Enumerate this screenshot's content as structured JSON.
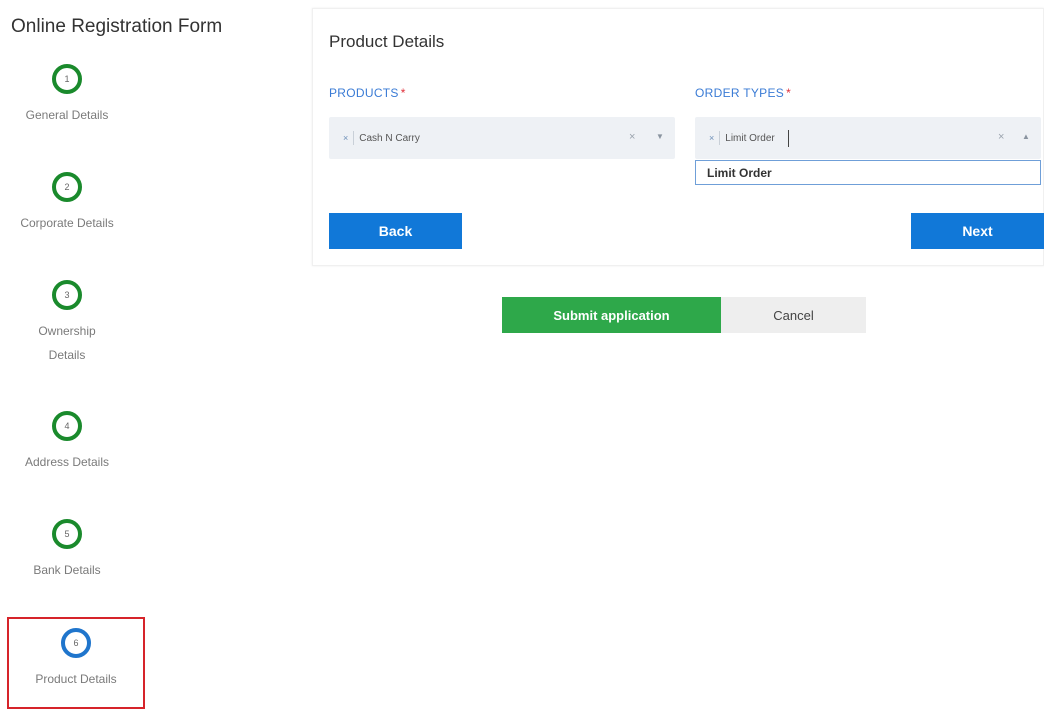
{
  "sidebar": {
    "title": "Online Registration Form",
    "steps": [
      {
        "number": "1",
        "label": "General Details"
      },
      {
        "number": "2",
        "label": "Corporate Details"
      },
      {
        "number": "3",
        "label": "Ownership Details"
      },
      {
        "number": "4",
        "label": "Address Details"
      },
      {
        "number": "5",
        "label": "Bank Details"
      },
      {
        "number": "6",
        "label": "Product Details"
      }
    ],
    "active_step": "6"
  },
  "section": {
    "title": "Product Details"
  },
  "products": {
    "label": "PRODUCTS",
    "required_mark": "*",
    "selected": "Cash N Carry",
    "chip_remove": "×",
    "clear": "×",
    "arrow": "▼"
  },
  "order_types": {
    "label": "ORDER TYPES",
    "required_mark": "*",
    "selected": "Limit Order",
    "chip_remove": "×",
    "clear": "×",
    "arrow": "▲",
    "options": [
      "Limit Order"
    ]
  },
  "buttons": {
    "back": "Back",
    "next": "Next",
    "submit": "Submit application",
    "cancel": "Cancel"
  },
  "colors": {
    "step_complete": "#1a8a2c",
    "step_active": "#1f75cc",
    "primary": "#1178d8",
    "submit": "#2ea84a",
    "highlight_box": "#d6242a"
  }
}
